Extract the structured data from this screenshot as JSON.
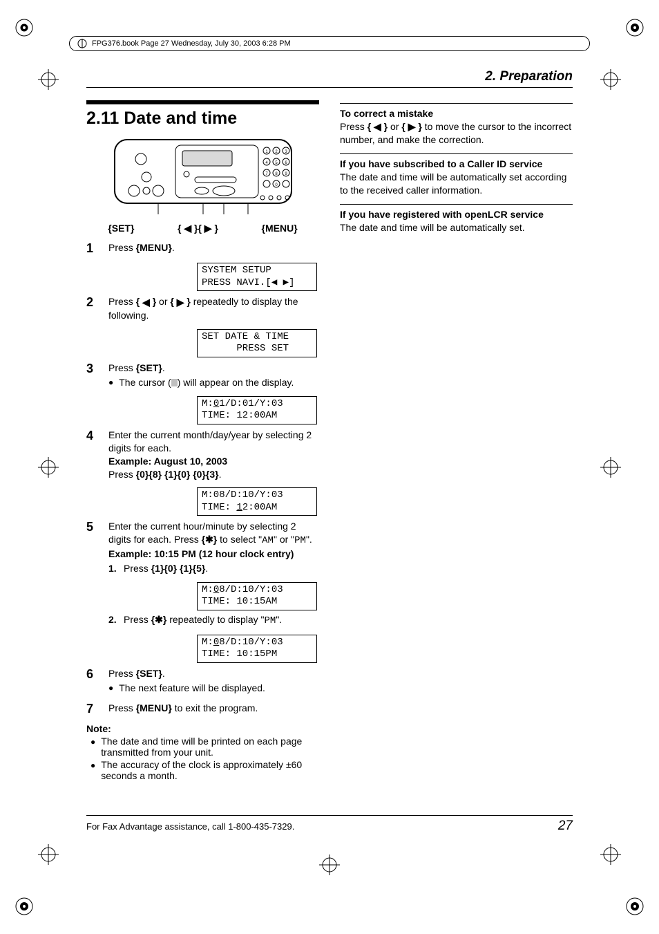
{
  "file_header": "FPG376.book  Page 27  Wednesday, July 30, 2003  6:28 PM",
  "chapter_title": "2. Preparation",
  "section_number_title": "2.11 Date and time",
  "device_labels": {
    "set": "{SET}",
    "nav": "{ ◀ }{ ▶ }",
    "menu": "{MENU}"
  },
  "steps": {
    "s1": {
      "num": "1",
      "text_pre": "Press ",
      "key": "{MENU}",
      "text_post": "."
    },
    "disp1_l1": "SYSTEM SETUP",
    "disp1_l2": "PRESS NAVI.[◀ ▶]",
    "s2": {
      "num": "2",
      "text": "Press { ◀ } or { ▶ } repeatedly to display the following."
    },
    "disp2_l1": "SET DATE & TIME",
    "disp2_l2": "      PRESS SET",
    "s3": {
      "num": "3",
      "text_pre": "Press ",
      "key": "{SET}",
      "text_post": ".",
      "bullet": "The cursor (",
      "bullet_post": ") will appear on the display."
    },
    "disp3_l1": "M:01/D:01/Y:03",
    "disp3_l2": "TIME: 12:00AM",
    "s4": {
      "num": "4",
      "line1": "Enter the current month/day/year by selecting 2 digits for each.",
      "example": "Example: August 10, 2003",
      "press_pre": "Press ",
      "keys": "{0}{8} {1}{0} {0}{3}",
      "press_post": "."
    },
    "disp4_l1": "M:08/D:10/Y:03",
    "disp4_l2": "TIME: 12:00AM",
    "s5": {
      "num": "5",
      "line1a": "Enter the current hour/minute by selecting 2 digits for each. Press ",
      "star": "{✱}",
      "line1b": " to select \"",
      "am": "AM",
      "line1c": "\" or \"",
      "pm": "PM",
      "line1d": "\".",
      "example": "Example: 10:15 PM (12 hour clock entry)",
      "sub1_num": "1.",
      "sub1_pre": "Press ",
      "sub1_keys": "{1}{0} {1}{5}",
      "sub1_post": "."
    },
    "disp5_l1": "M:08/D:10/Y:03",
    "disp5_l2": "TIME: 10:15AM",
    "s5b": {
      "sub2_num": "2.",
      "sub2_pre": "Press ",
      "sub2_key": "{✱}",
      "sub2_mid": " repeatedly to display \"",
      "sub2_pm": "PM",
      "sub2_post": "\"."
    },
    "disp6_l1": "M:08/D:10/Y:03",
    "disp6_l2": "TIME: 10:15PM",
    "s6": {
      "num": "6",
      "text_pre": "Press ",
      "key": "{SET}",
      "text_post": ".",
      "bullet": "The next feature will be displayed."
    },
    "s7": {
      "num": "7",
      "text_pre": "Press ",
      "key": "{MENU}",
      "text_post": " to exit the program."
    }
  },
  "note": {
    "heading": "Note:",
    "b1": "The date and time will be printed on each page transmitted from your unit.",
    "b2": "The accuracy of the clock is approximately ±60 seconds a month."
  },
  "right": {
    "h1": "To correct a mistake",
    "p1a": "Press ",
    "p1_key1": "{ ◀ }",
    "p1b": " or ",
    "p1_key2": "{ ▶ }",
    "p1c": " to move the cursor to the incorrect number, and make the correction.",
    "h2": "If you have subscribed to a Caller ID service",
    "p2": "The date and time will be automatically set according to the received caller information.",
    "h3": "If you have registered with openLCR service",
    "p3": "The date and time will be automatically set."
  },
  "footer_text": "For Fax Advantage assistance, call 1-800-435-7329.",
  "footer_page": "27"
}
